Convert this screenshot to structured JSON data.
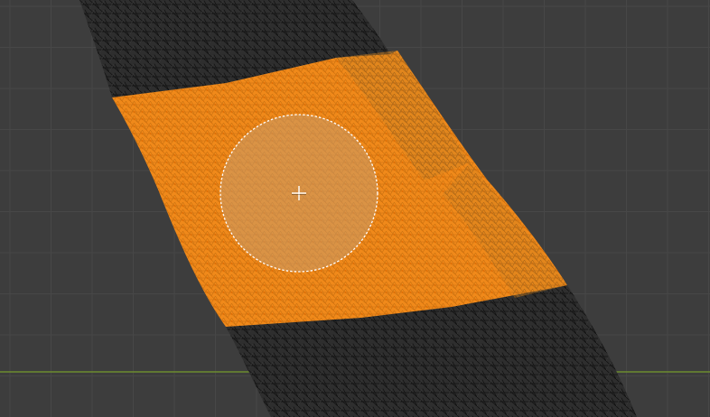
{
  "viewport": {
    "view": "3d-viewport",
    "mode": "edit-mode-mesh",
    "grid": true,
    "colors": {
      "background": "#3d3d3d",
      "grid_line": "#474747",
      "x_axis": "#6d8b2e",
      "mesh_dark": "#2f2f2f",
      "mesh_wire": "#0e0e0e",
      "mesh_face": "#5a5a5a",
      "selection": "#f28c14",
      "selection_light": "#f7a544",
      "selection_dot": "#e36f00",
      "brush_circle": "#ffffff",
      "brush_fill": "#c99a6a"
    }
  },
  "mesh": {
    "name": "tube-mesh",
    "selected_region": "middle-band-faces-selected"
  },
  "tool": {
    "name": "circle-select",
    "cursor_icon": "crosshair-icon"
  }
}
